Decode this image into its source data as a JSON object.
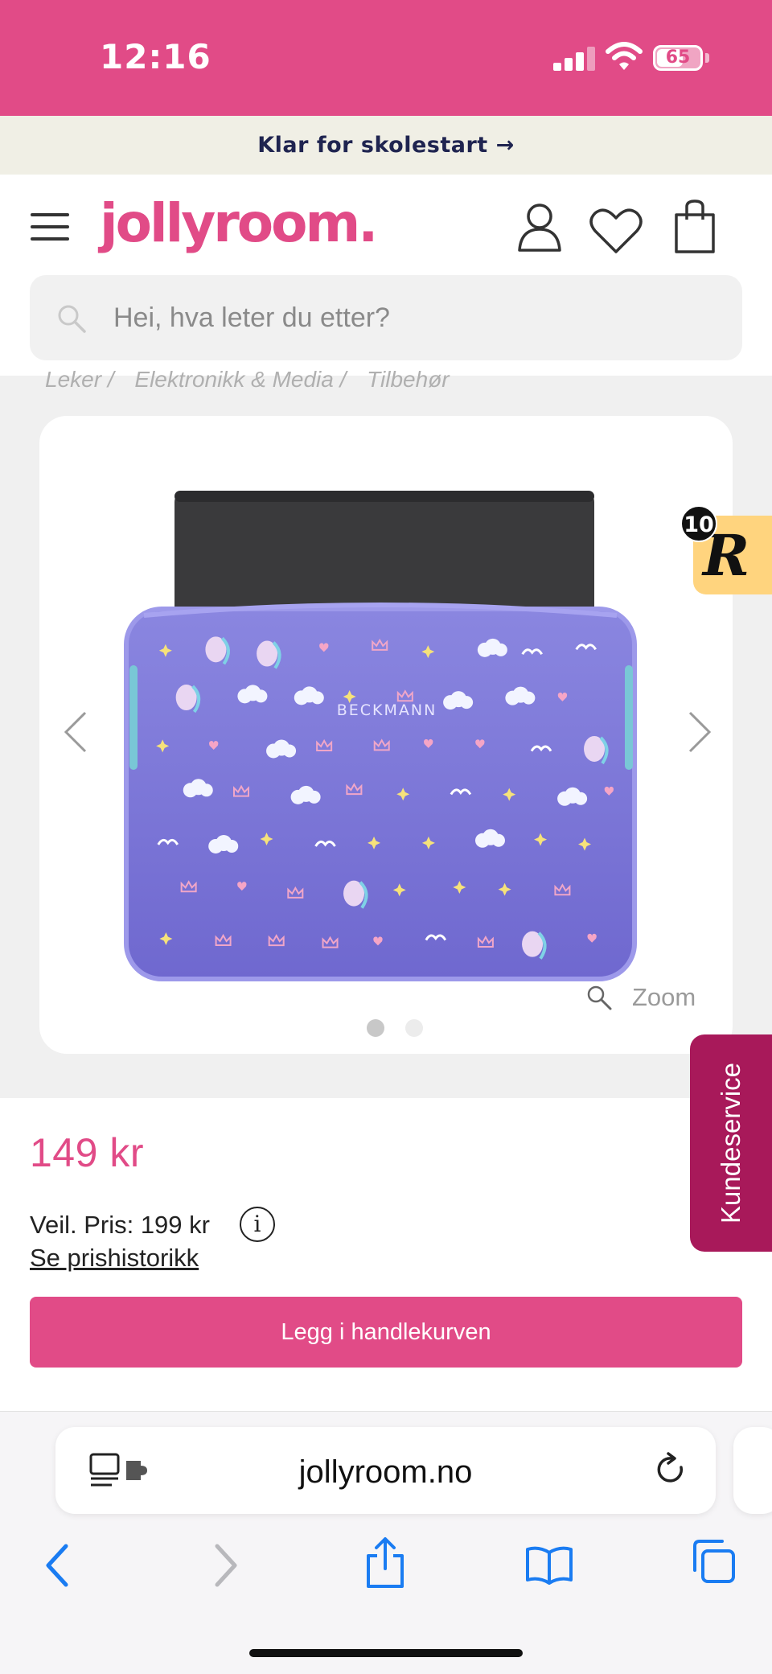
{
  "status_bar": {
    "time": "12:16",
    "battery_percent": "65",
    "battery_level": 0.65
  },
  "promo": {
    "text": "Klar for skolestart →"
  },
  "header": {
    "logo": "jollyroom."
  },
  "search": {
    "placeholder": "Hei, hva leter du etter?"
  },
  "breadcrumb": [
    "Leker /",
    "Elektronikk & Media /",
    "Tilbehør"
  ],
  "gallery": {
    "zoom_label": "Zoom",
    "image_count": 2,
    "active_index": 0,
    "product_brand_mark": "BECKMANN"
  },
  "reward": {
    "count": "10",
    "letter": "R"
  },
  "side_tab": {
    "label": "Kundeservice"
  },
  "product": {
    "price": "149 kr",
    "recommended_price": "Veil. Pris: 199 kr",
    "price_history_link": "Se prishistorikk",
    "add_to_cart": "Legg i handlekurven"
  },
  "browser": {
    "url": "jollyroom.no"
  },
  "colors": {
    "brand": "#e14b87",
    "promo_bg": "#f0efe5",
    "promo_text": "#1f2450",
    "kundeservice": "#a8195a",
    "ios_blue": "#1a7cf2"
  }
}
